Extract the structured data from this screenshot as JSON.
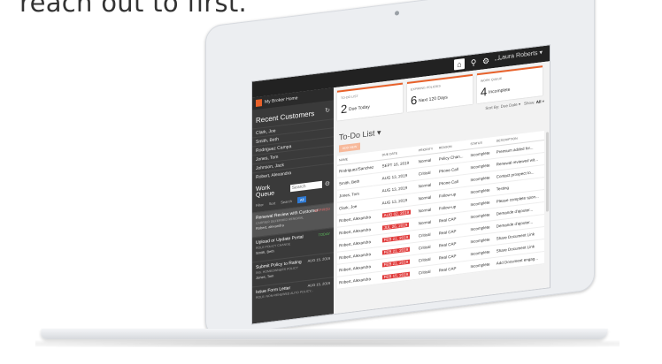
{
  "headline": "reach out to first.",
  "app": {
    "name": "My Broker Home",
    "user": "Laura Roberts",
    "topbar_icons": [
      "home-icon",
      "search-icon",
      "gear-icon",
      "more-icon"
    ]
  },
  "sidebar": {
    "recent_title": "Recent Customers",
    "customers": [
      "Clark, Joe",
      "Smith, Beth",
      "Rodriguez Campa",
      "Jones, Tom",
      "Johnson, Jack",
      "Robert, Alexandra"
    ],
    "work_queue_title": "Work Queue",
    "search_placeholder": "Search",
    "filters": [
      "Filter",
      "Sort",
      "Search",
      "All"
    ],
    "queue_items": [
      {
        "title": "Renewal Review with Customer",
        "sub": "CARRIER DEFERRED RENEWAL",
        "who": "Robert, alexandra",
        "date": "EXPIRED",
        "tone": "r"
      },
      {
        "title": "Upload or Update Portal",
        "sub": "ROLE POLICY CHANGE",
        "who": "Smith, Beth",
        "date": "TODAY",
        "tone": "g"
      },
      {
        "title": "Submit Policy to Rating",
        "sub": "INS. HOMEOWNERS POLICY",
        "who": "Jones, Tom",
        "date": "AUG 15, 2019",
        "tone": "w"
      },
      {
        "title": "Issue Form Letter",
        "sub": "ROLE: NON-RENEWED AUTO POLICY...",
        "who": "",
        "date": "AUG 15, 2019",
        "tone": "w"
      }
    ]
  },
  "cards": [
    {
      "label": "TO-DO LIST",
      "number": "2",
      "text": "Due Today"
    },
    {
      "label": "EXPIRING POLICIES",
      "number": "6",
      "text": "Next 120 Days"
    },
    {
      "label": "WORK QUEUE",
      "number": "4",
      "text": "Incomplete"
    }
  ],
  "todo": {
    "sort_label": "Sort By: Due Date",
    "show_label": "Show:",
    "show_value": "All",
    "title": "To-Do List",
    "add_label": "ADD NEW",
    "columns": [
      "NAME",
      "DUE DATE",
      "PRIORITY",
      "REASON",
      "STATUS",
      "DESCRIPTION"
    ],
    "rows": [
      {
        "name": "Rodriguez/Sanchez",
        "due": "SEPT 16, 2019",
        "overdue": false,
        "priority": "Normal",
        "reason": "Policy Chan...",
        "status": "Incomplete",
        "desc": "Premium added for..."
      },
      {
        "name": "Smith, Beth",
        "due": "AUG 13, 2019",
        "overdue": false,
        "priority": "Critical",
        "reason": "Phone Call",
        "status": "Incomplete",
        "desc": "Renewal reviewed wit..."
      },
      {
        "name": "Jones, Tom",
        "due": "AUG 13, 2019",
        "overdue": false,
        "priority": "Normal",
        "reason": "Phone Call",
        "status": "Incomplete",
        "desc": "Contact prospect to..."
      },
      {
        "name": "Clark, Joe",
        "due": "AUG 13, 2019",
        "overdue": false,
        "priority": "Normal",
        "reason": "Follow-up",
        "status": "Incomplete",
        "desc": "Testing"
      },
      {
        "name": "Robert, Alexandra",
        "due": "AUG 02, 2019",
        "overdue": true,
        "priority": "Normal",
        "reason": "Follow-up",
        "status": "Incomplete",
        "desc": "Please complete spon..."
      },
      {
        "name": "Robert, Alexandra",
        "due": "JUL 26, 2019",
        "overdue": true,
        "priority": "Normal",
        "reason": "Real CAP",
        "status": "Incomplete",
        "desc": "Demande d'ajouter..."
      },
      {
        "name": "Robert, Alexandra",
        "due": "FEB 21, 2019",
        "overdue": true,
        "priority": "Critical",
        "reason": "Real CAP",
        "status": "Incomplete",
        "desc": "Demande d'ajouter..."
      },
      {
        "name": "Robert, Alexandra",
        "due": "FEB 21, 2019",
        "overdue": true,
        "priority": "Critical",
        "reason": "Real CAP",
        "status": "Incomplete",
        "desc": "Share Document Link"
      },
      {
        "name": "Robert, Alexandra",
        "due": "FEB 21, 2019",
        "overdue": true,
        "priority": "Critical",
        "reason": "Real CAP",
        "status": "Incomplete",
        "desc": "Share Document Link"
      },
      {
        "name": "Robert, Alexandra",
        "due": "FEB 15, 2019",
        "overdue": true,
        "priority": "Critical",
        "reason": "Real CAP",
        "status": "Incomplete",
        "desc": "Add Document engag..."
      }
    ]
  }
}
